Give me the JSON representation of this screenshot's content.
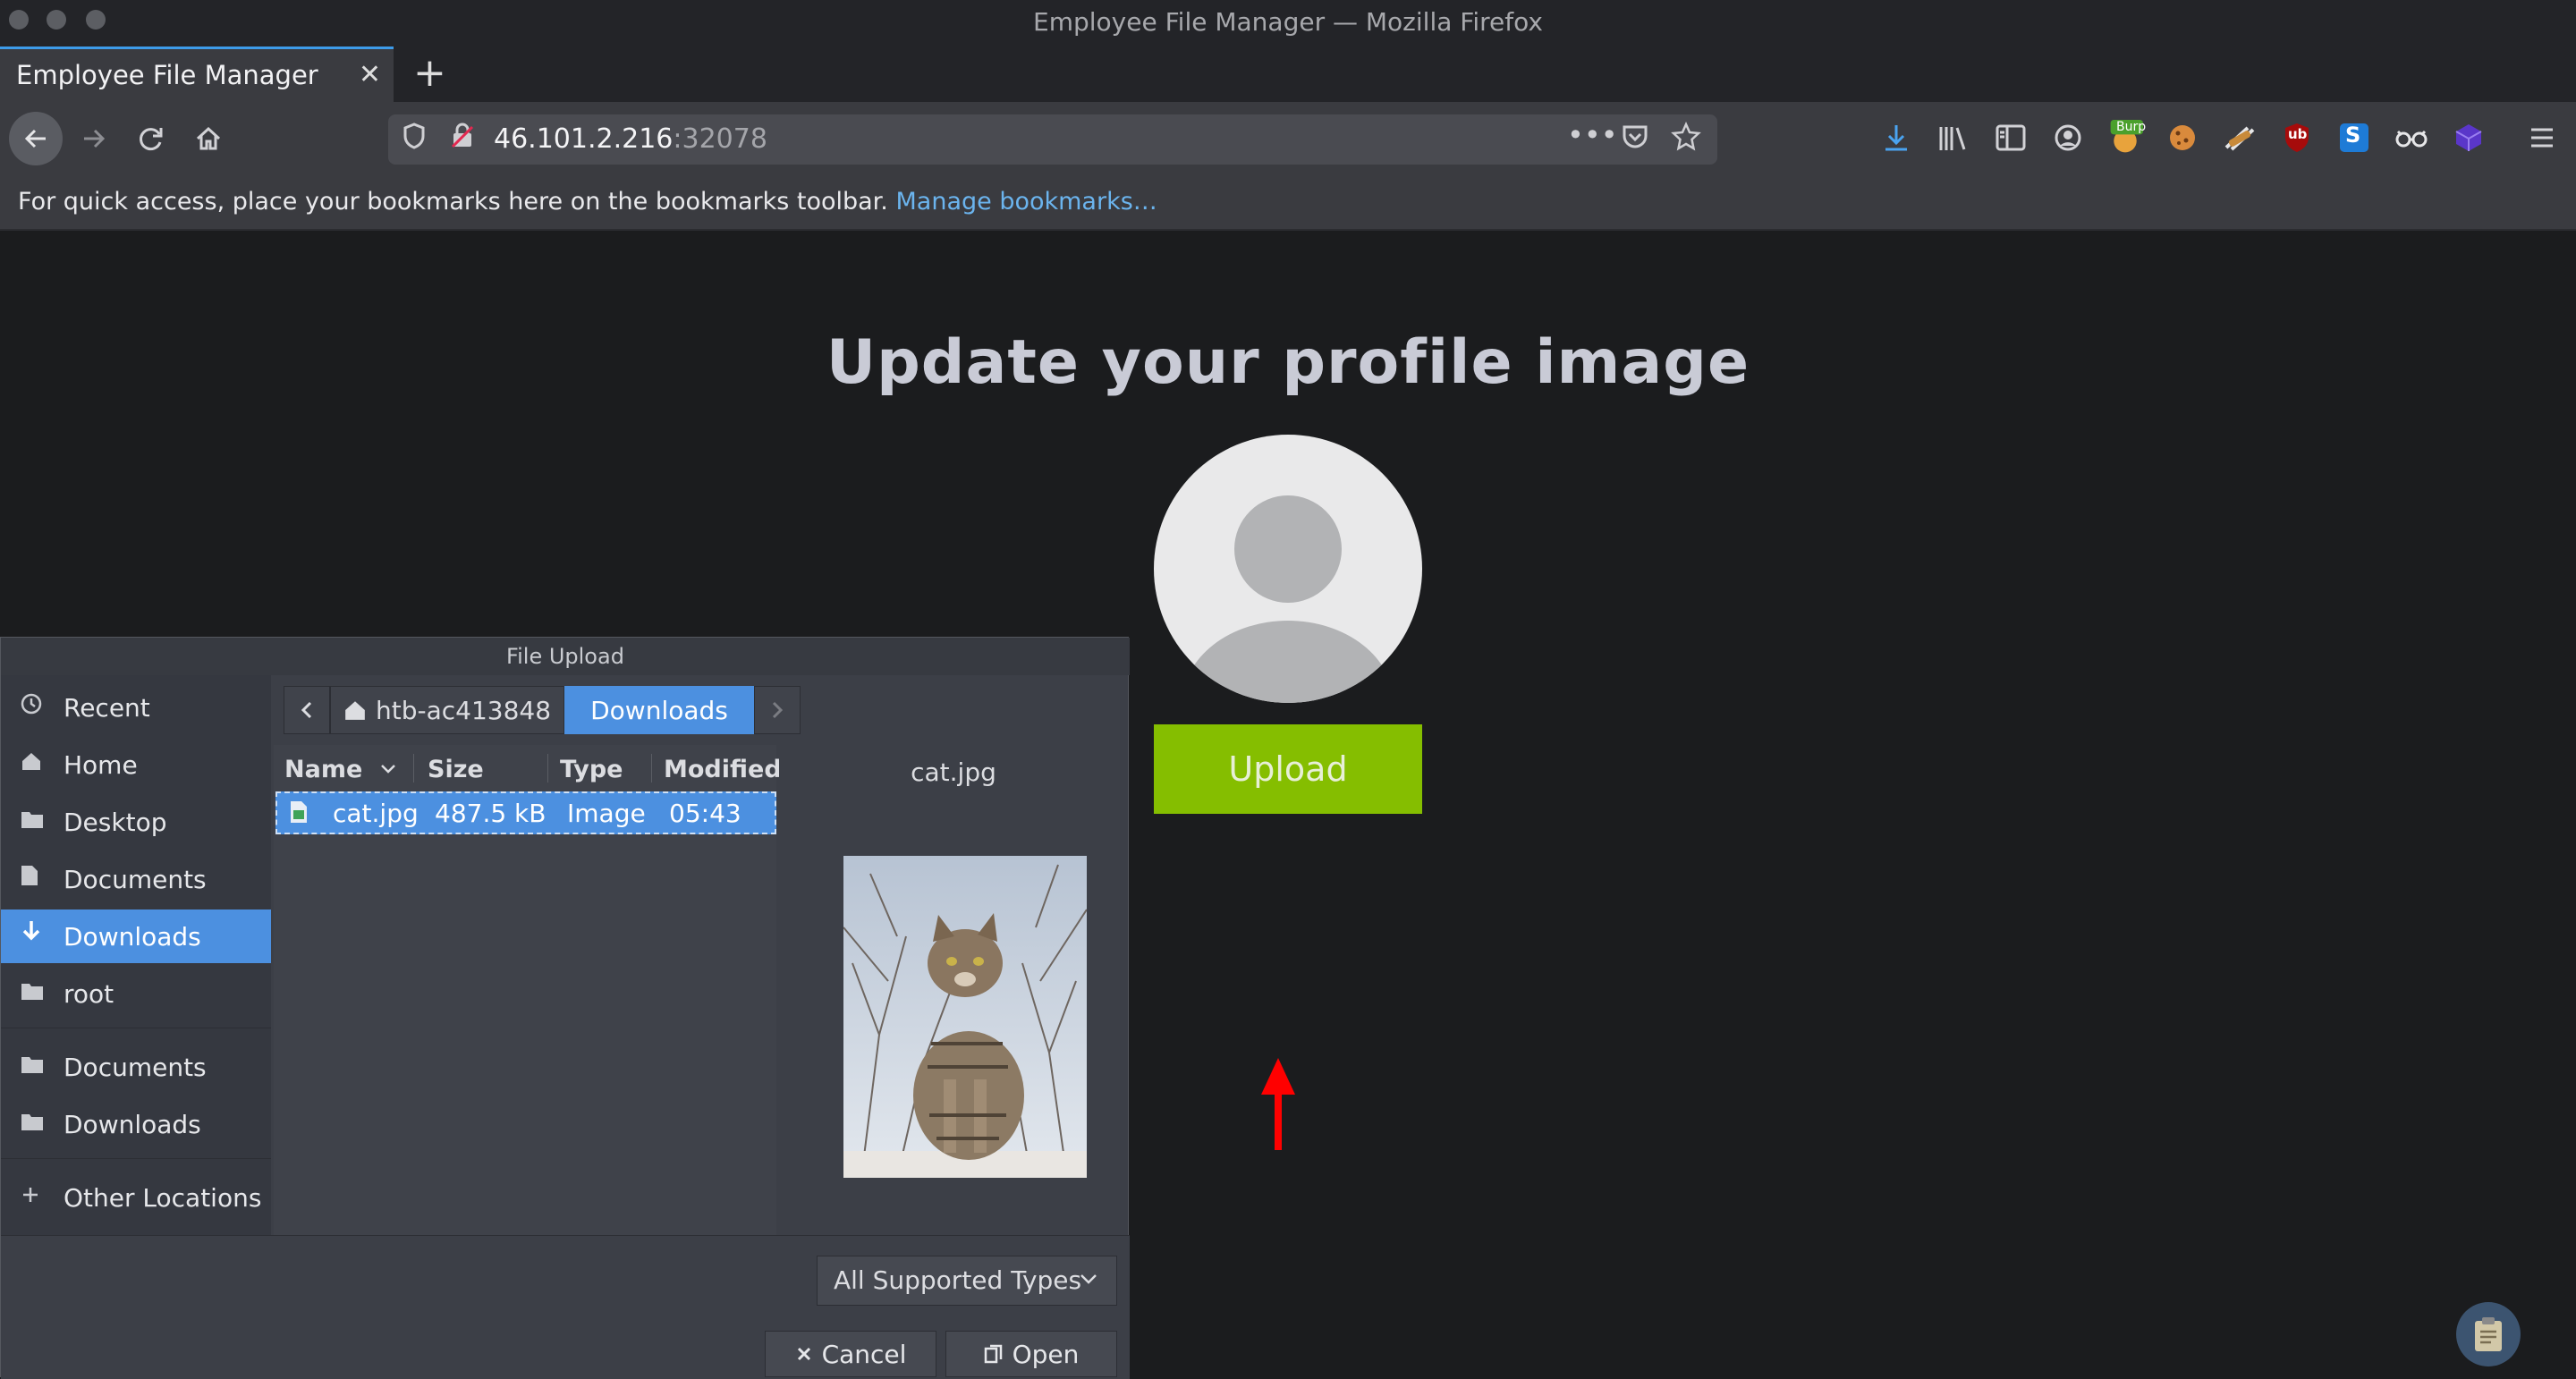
{
  "window": {
    "title": "Employee File Manager — Mozilla Firefox"
  },
  "tabs": [
    {
      "label": "Employee File Manager",
      "close": "✕"
    }
  ],
  "new_tab": "+",
  "nav": {
    "url_host": "46.101.2.216",
    "url_port": ":32078",
    "page_actions": "•••"
  },
  "bookmarks_bar": {
    "text": "For quick access, place your bookmarks here on the bookmarks toolbar.",
    "link": "Manage bookmarks…"
  },
  "extensions": {
    "burp_badge": "Burp",
    "ublock": "ub",
    "s_ext": "S"
  },
  "page": {
    "heading": "Update your profile image",
    "upload_button": "Upload"
  },
  "dialog": {
    "title": "File Upload",
    "places": [
      {
        "label": "Recent",
        "icon": "clock-icon"
      },
      {
        "label": "Home",
        "icon": "home-icon"
      },
      {
        "label": "Desktop",
        "icon": "folder-icon"
      },
      {
        "label": "Documents",
        "icon": "document-icon"
      },
      {
        "label": "Downloads",
        "icon": "download-icon",
        "selected": true
      },
      {
        "label": "root",
        "icon": "folder-icon"
      },
      {
        "label": "Documents",
        "icon": "folder-icon"
      },
      {
        "label": "Downloads",
        "icon": "folder-icon"
      },
      {
        "label": "Other Locations",
        "icon": "plus-icon"
      }
    ],
    "path": {
      "home": "htb-ac413848",
      "current": "Downloads"
    },
    "columns": {
      "name": "Name",
      "size": "Size",
      "type": "Type",
      "modified": "Modified"
    },
    "files": [
      {
        "name": "cat.jpg",
        "size": "487.5 kB",
        "type": "Image",
        "modified": "05:43"
      }
    ],
    "preview_name": "cat.jpg",
    "filter": "All Supported Types",
    "cancel_button": "Cancel",
    "open_button": "Open"
  },
  "colors": {
    "upload": "#85be00",
    "selection": "#4c90e0",
    "annotation_arrow": "#ff0000",
    "link": "#6bb4ee"
  }
}
